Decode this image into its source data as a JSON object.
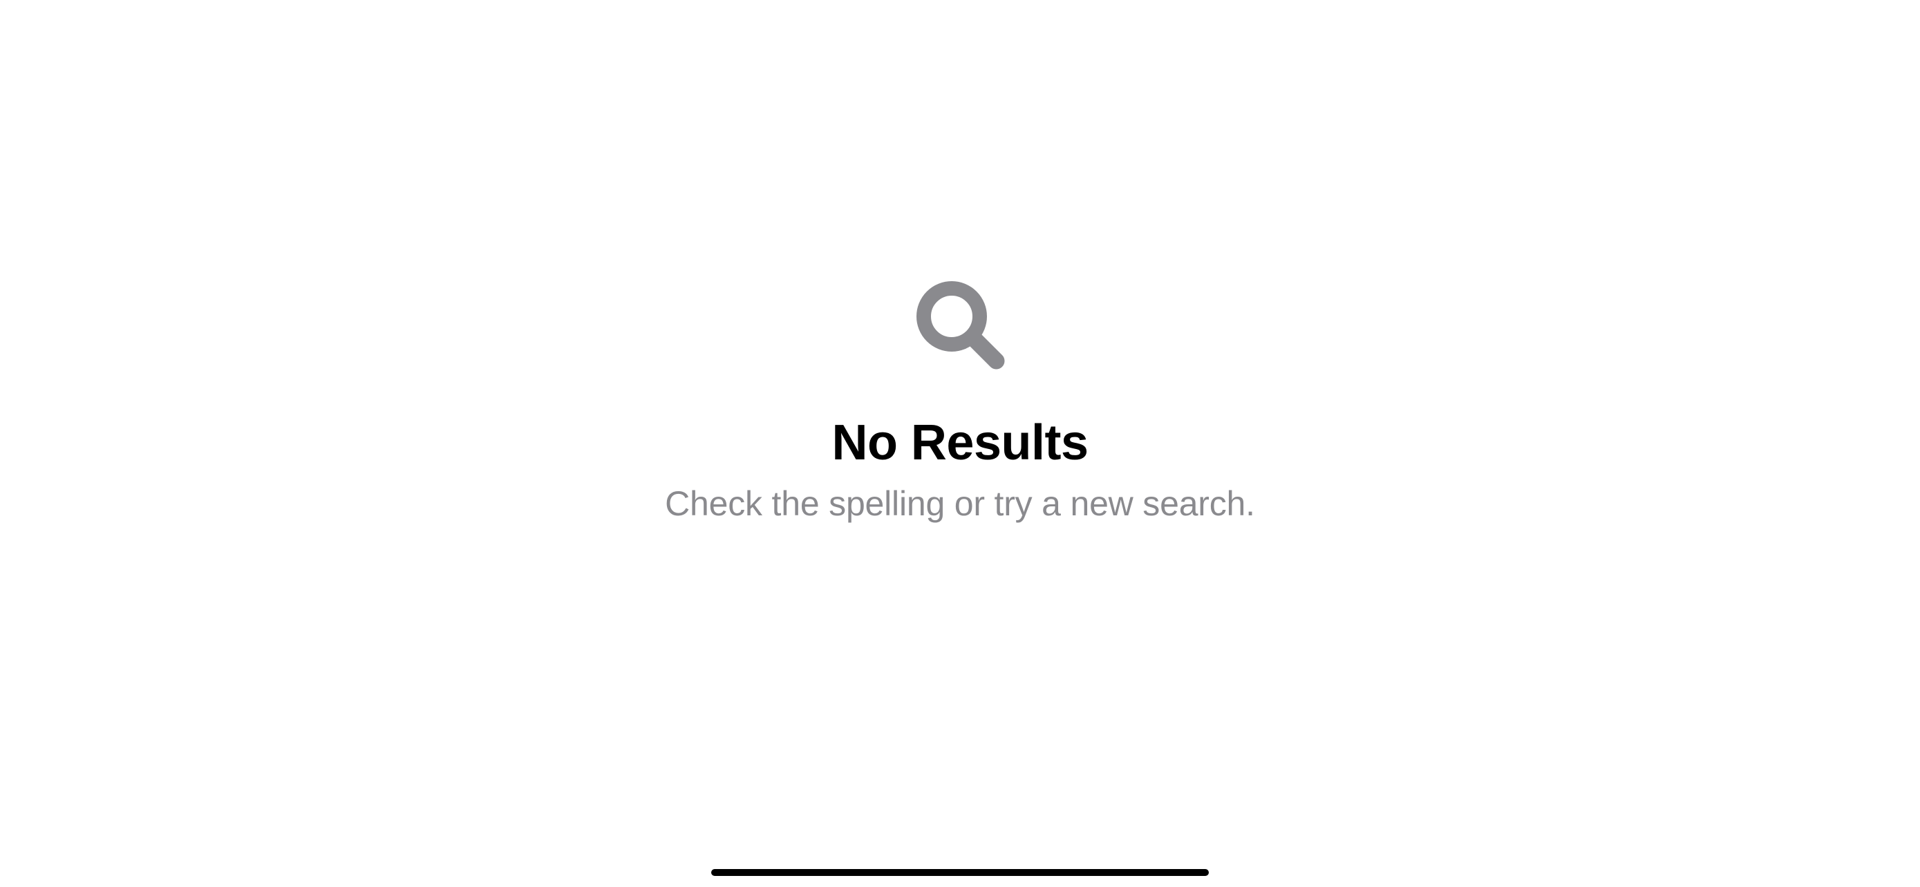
{
  "emptyState": {
    "title": "No Results",
    "subtitle": "Check the spelling or try a new search."
  },
  "icons": {
    "search": "search-icon"
  },
  "colors": {
    "iconGray": "#8a8a8e",
    "titleText": "#000000",
    "subtitleText": "#8a8a8e",
    "background": "#ffffff"
  }
}
